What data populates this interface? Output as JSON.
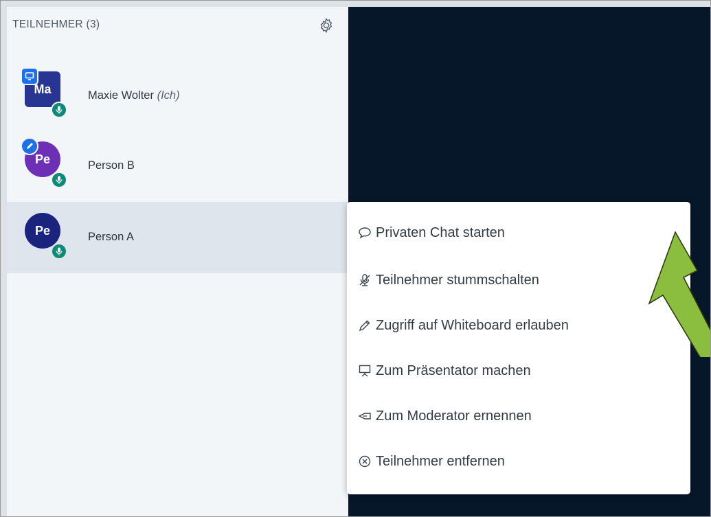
{
  "sidebar": {
    "title": "TEILNEHMER (3)",
    "users": [
      {
        "initials": "Ma",
        "name": "Maxie Wolter",
        "suffix": "(Ich)",
        "avatar_color": "#283593",
        "shape": "square",
        "role_icon": "presenter-icon"
      },
      {
        "initials": "Pe",
        "name": "Person B",
        "suffix": "",
        "avatar_color": "#6d2fb5",
        "shape": "circle",
        "role_icon": "pencil-icon"
      },
      {
        "initials": "Pe",
        "name": "Person A",
        "suffix": "",
        "avatar_color": "#1a237e",
        "shape": "circle",
        "role_icon": ""
      }
    ]
  },
  "menu": {
    "items": [
      {
        "label": "Privaten Chat starten",
        "icon": "chat-icon"
      },
      {
        "label": "Teilnehmer stummschalten",
        "icon": "mute-icon"
      },
      {
        "label": "Zugriff auf Whiteboard erlauben",
        "icon": "pencil-icon"
      },
      {
        "label": "Zum Präsentator machen",
        "icon": "presentation-icon"
      },
      {
        "label": "Zum Moderator ernennen",
        "icon": "promote-icon"
      },
      {
        "label": "Teilnehmer entfernen",
        "icon": "remove-icon"
      }
    ]
  },
  "colors": {
    "stage": "#06172a",
    "sidebar": "#f3f6f9",
    "mic_badge": "#0f8a78",
    "role_badge": "#1e70e8",
    "arrow": "#8bbd3f"
  }
}
